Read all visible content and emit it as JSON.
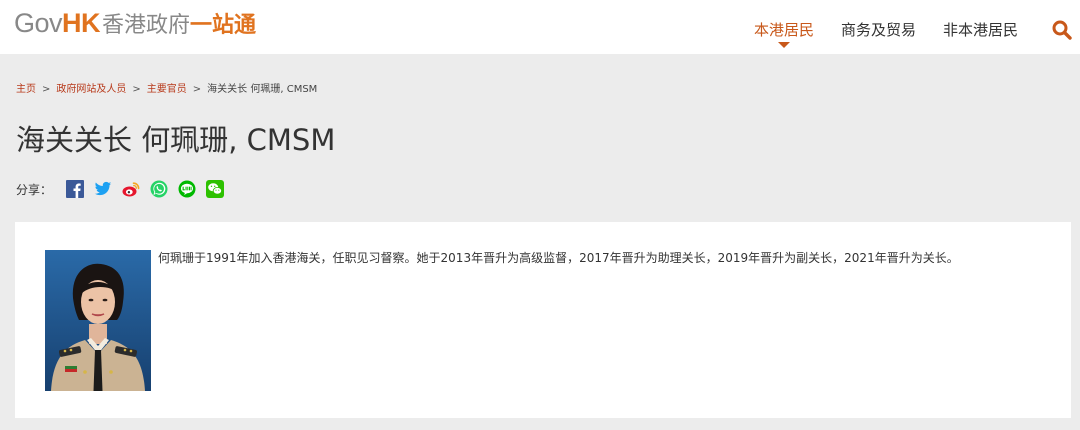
{
  "logo": {
    "gov": "Gov",
    "hk": "HK",
    "zh_part1": "香港政府",
    "zh_part2": "一站通"
  },
  "nav": {
    "items": [
      {
        "label": "本港居民",
        "active": true
      },
      {
        "label": "商务及贸易",
        "active": false
      },
      {
        "label": "非本港居民",
        "active": false
      }
    ],
    "search_icon": "search-icon"
  },
  "breadcrumb": {
    "items": [
      "主页",
      "政府网站及人员",
      "主要官员"
    ],
    "separator": ">",
    "current": "海关关长 何珮珊, CMSM"
  },
  "page_title": "海关关长 何珮珊, CMSM",
  "share": {
    "label": "分享：",
    "icons": [
      "facebook-icon",
      "twitter-icon",
      "weibo-icon",
      "whatsapp-icon",
      "line-icon",
      "wechat-icon"
    ]
  },
  "profile": {
    "bio": "何珮珊于1991年加入香港海关，任职见习督察。她于2013年晋升为高级监督，2017年晋升为助理关长，2019年晋升为副关长，2021年晋升为关长。"
  },
  "colors": {
    "accent": "#c8581a",
    "brand_orange": "#e0731f",
    "background": "#ececec",
    "link": "#b83a1b"
  }
}
